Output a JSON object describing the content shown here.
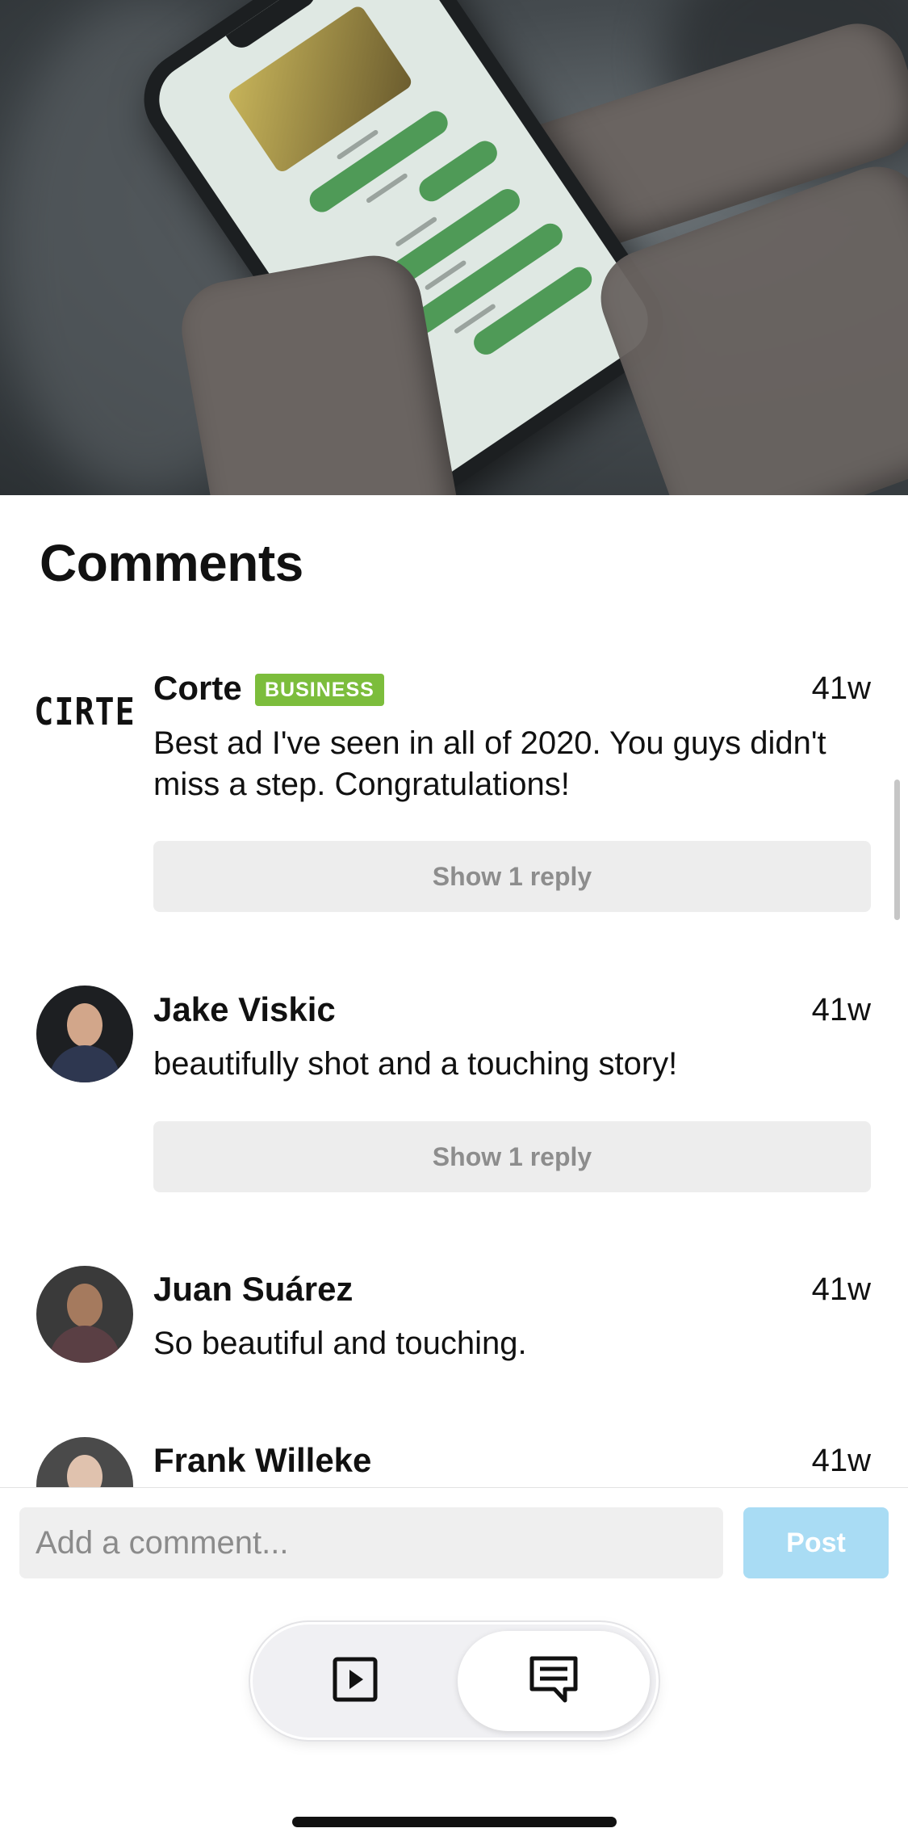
{
  "hero": {
    "description_icon": "video-thumbnail"
  },
  "comments": {
    "title": "Comments",
    "items": [
      {
        "name": "Corte",
        "avatar_text": "CIRTE",
        "badge": "BUSINESS",
        "time": "41w",
        "text": "Best ad I've seen in all of 2020. You guys didn't miss a step. Congratulations!",
        "reply_label": "Show 1 reply"
      },
      {
        "name": "Jake Viskic",
        "time": "41w",
        "text": "beautifully shot and a touching story!",
        "reply_label": "Show 1 reply"
      },
      {
        "name": "Juan Suárez",
        "time": "41w",
        "text": "So beautiful and touching."
      },
      {
        "name": "Frank Willeke",
        "time": "41w"
      }
    ]
  },
  "composer": {
    "placeholder": "Add a comment...",
    "post_label": "Post"
  },
  "toggle": {
    "left_icon": "play-icon",
    "right_icon": "comments-icon",
    "selected": "comments"
  },
  "colors": {
    "badge": "#7cbd3c",
    "post_disabled": "#a9dcf4",
    "reply_bg": "#ededed"
  }
}
